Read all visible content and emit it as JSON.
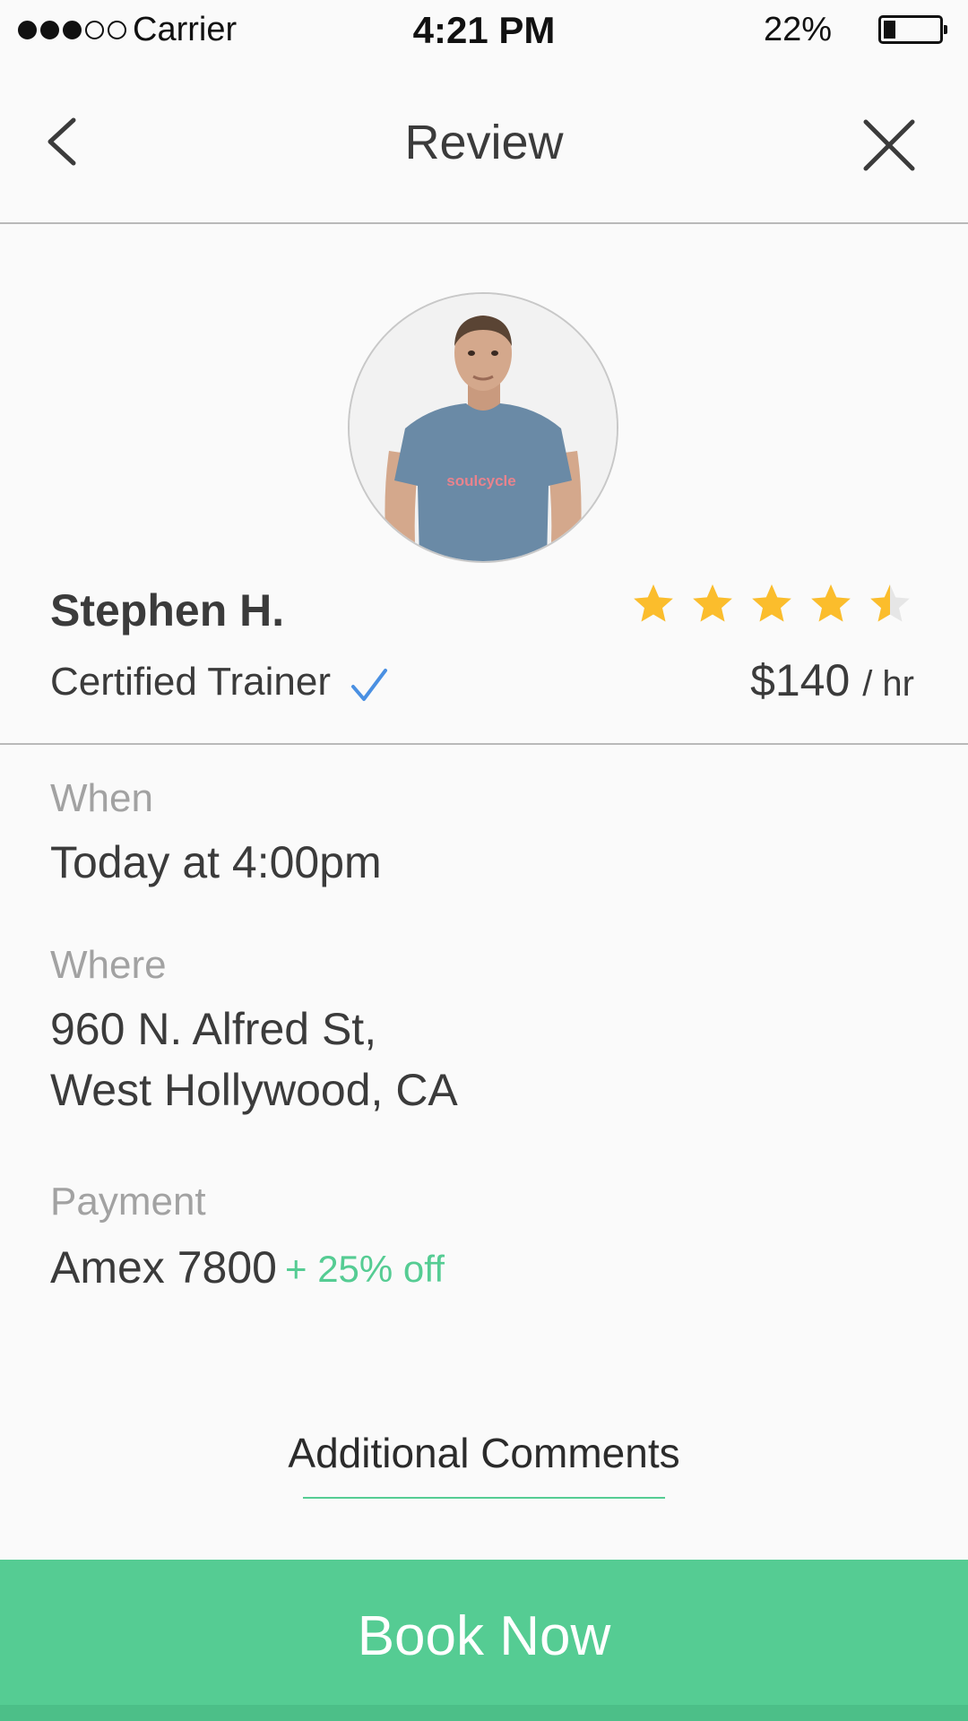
{
  "status_bar": {
    "carrier": "Carrier",
    "time": "4:21 PM",
    "battery_percent": "22%",
    "battery_level": 0.22,
    "signal_bars_filled": 3,
    "signal_bars_total": 5
  },
  "nav": {
    "title": "Review",
    "back_icon": "chevron-left-icon",
    "close_icon": "close-icon"
  },
  "trainer": {
    "name": "Stephen H.",
    "title": "Certified Trainer",
    "verified_icon": "checkmark-icon",
    "rating": 4.5,
    "rating_max": 5,
    "price": "$140",
    "price_unit": "/ hr",
    "avatar_shirt_text": "soulcycle"
  },
  "details": {
    "when_label": "When",
    "when_value": "Today at 4:00pm",
    "where_label": "Where",
    "where_line1": "960 N. Alfred St,",
    "where_line2": "West Hollywood, CA",
    "payment_label": "Payment",
    "payment_value": "Amex 7800",
    "discount": "+ 25% off"
  },
  "comments": {
    "label": "Additional Comments"
  },
  "book_button": {
    "label": "Book Now"
  },
  "colors": {
    "accent": "#55cc93",
    "star": "#fbbd2c",
    "verified": "#4a90e2",
    "text": "#3b3b3b",
    "muted": "#a2a2a2"
  }
}
